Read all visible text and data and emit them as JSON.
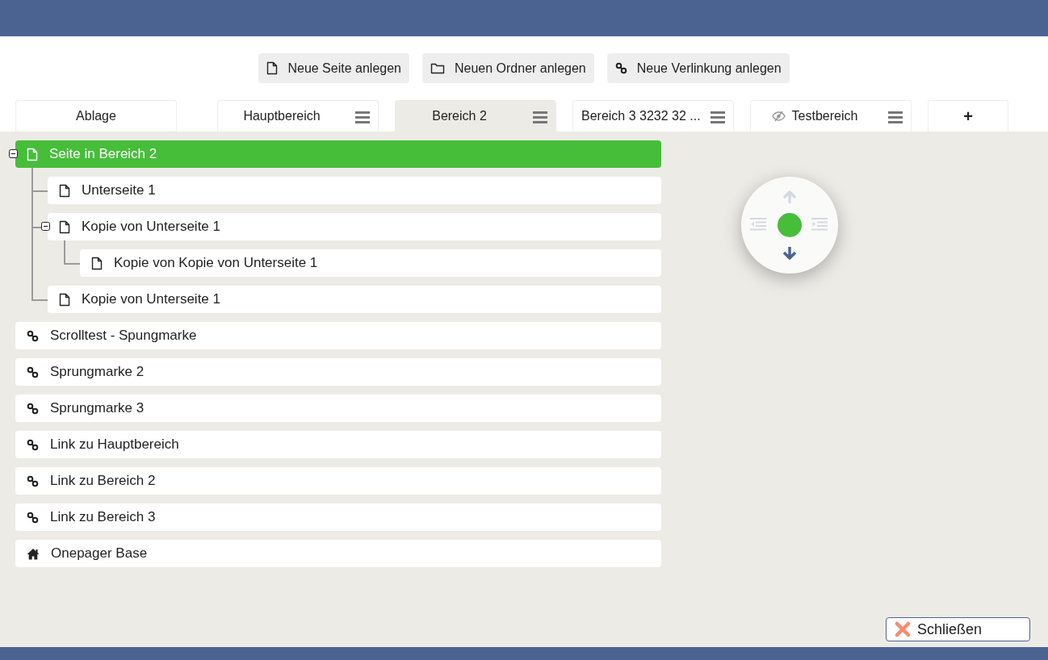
{
  "toolbar": {
    "buttons": [
      {
        "label": "Neue Seite anlegen",
        "kind": "page"
      },
      {
        "label": "Neuen Ordner anlegen",
        "kind": "folder"
      },
      {
        "label": "Neue Verlinkung anlegen",
        "kind": "link"
      }
    ]
  },
  "tabs": [
    {
      "label": "Ablage",
      "kind": "plain",
      "selected": false
    },
    {
      "label": "Hauptbereich",
      "kind": "menu",
      "selected": false,
      "hidden": false
    },
    {
      "label": "Bereich 2",
      "kind": "menu",
      "selected": true,
      "hidden": false
    },
    {
      "label": "Bereich 3 3232 32 ...",
      "kind": "menu",
      "selected": false,
      "hidden": false
    },
    {
      "label": "Testbereich",
      "kind": "menu",
      "selected": false,
      "hidden": true
    },
    {
      "label": "+",
      "kind": "add",
      "selected": false
    }
  ],
  "tree": [
    {
      "label": "Seite in Bereich 2",
      "kind": "page",
      "selected": true,
      "expanded": true,
      "children": [
        {
          "label": "Unterseite 1",
          "kind": "page",
          "selected": false
        },
        {
          "label": "Kopie von Unterseite 1",
          "kind": "page",
          "selected": false,
          "expanded": true,
          "children": [
            {
              "label": "Kopie von Kopie von Unterseite 1",
              "kind": "page",
              "selected": false
            }
          ]
        },
        {
          "label": "Kopie von Unterseite 1",
          "kind": "page",
          "selected": false
        }
      ]
    },
    {
      "label": "Scrolltest - Spungmarke",
      "kind": "link",
      "selected": false
    },
    {
      "label": "Sprungmarke 2",
      "kind": "link",
      "selected": false
    },
    {
      "label": "Sprungmarke 3",
      "kind": "link",
      "selected": false
    },
    {
      "label": "Link zu Hauptbereich",
      "kind": "link",
      "selected": false
    },
    {
      "label": "Link zu Bereich 2",
      "kind": "link",
      "selected": false
    },
    {
      "label": "Link zu Bereich 3",
      "kind": "link",
      "selected": false
    },
    {
      "label": "Onepager Base",
      "kind": "home",
      "selected": false
    }
  ],
  "navigator": {
    "up": {
      "disabled": true
    },
    "down": {
      "disabled": false
    },
    "outdent": {
      "disabled": true
    },
    "indent": {
      "disabled": true
    }
  },
  "close_button": {
    "label": "Schließen"
  }
}
